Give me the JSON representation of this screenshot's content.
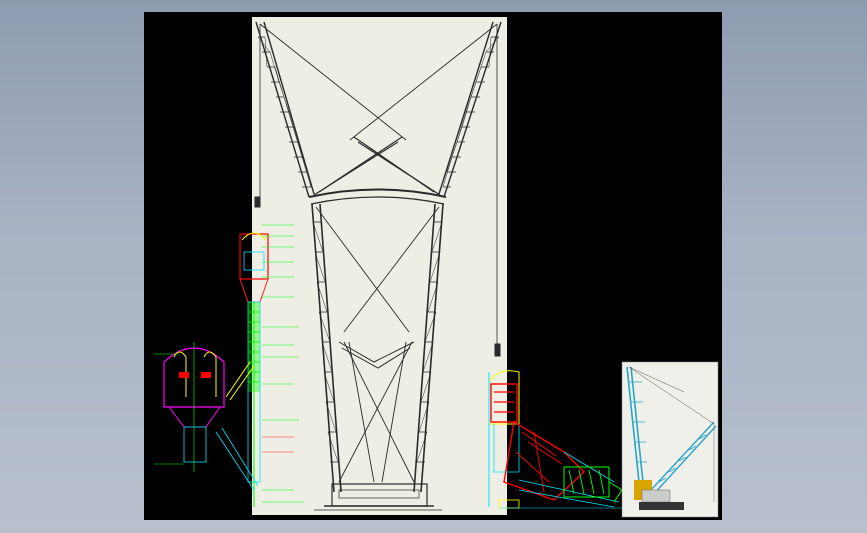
{
  "colors": {
    "background_top": "#8f9bb0",
    "background_bottom": "#b8c0ce",
    "canvas": "#000000",
    "sheet": "#eeeee4",
    "structure": "#2a2a2a",
    "annotation": "#00ff00",
    "dimension": "#ff2020",
    "detail_red": "#ff0000",
    "detail_cyan": "#00e5ff",
    "detail_yellow": "#ffff00",
    "detail_magenta": "#ff00ff",
    "crane_boom": "#2aa5c8"
  },
  "drawing": {
    "main_sheet": {
      "description_icon": "crane-double-boom-elevation"
    },
    "detail_left": {
      "description_icon": "boom-head-section-detail"
    },
    "detail_right": {
      "description_icon": "boom-hinge-assembly-detail"
    },
    "thumbnail": {
      "description_icon": "crawler-crane-render"
    }
  }
}
